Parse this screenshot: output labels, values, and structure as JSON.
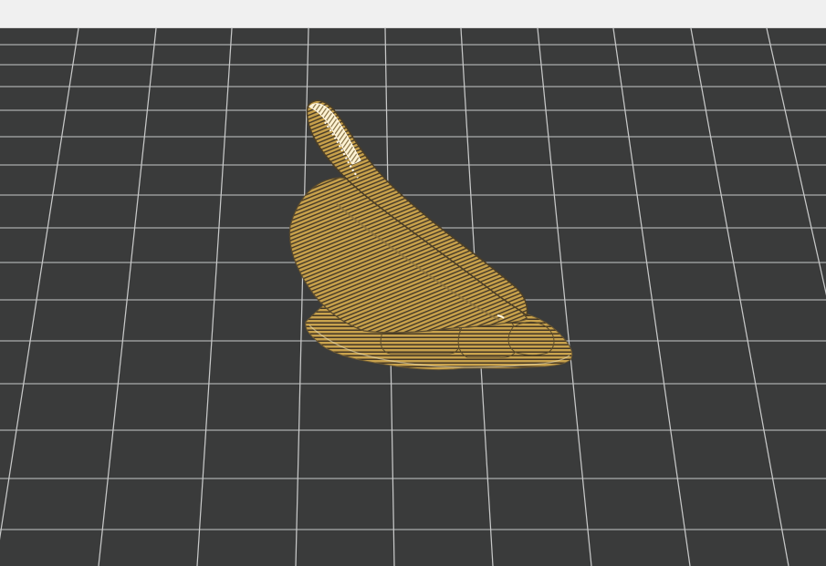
{
  "viewport": {
    "background_color": "#3a3b3b",
    "grid_color": "#c7c8c8",
    "model_color": "#c8a24d",
    "model_shadow_color": "#3d3322",
    "highlight_color": "#ffffff"
  },
  "toolbar": {
    "background_color": "#f0f0f0"
  },
  "icons": {
    "model": "sliced-model-icon"
  }
}
